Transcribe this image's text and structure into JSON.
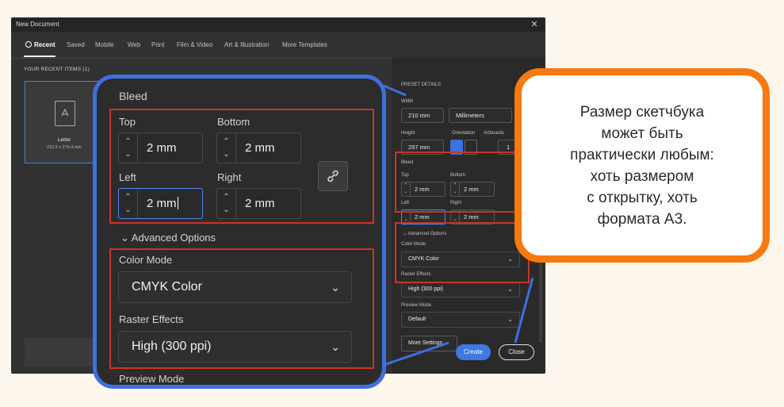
{
  "dialog": {
    "title": "New Document",
    "tabs": [
      "Recent",
      "Saved",
      "Mobile",
      "Web",
      "Print",
      "Film & Video",
      "Art & Illustration",
      "More Templates"
    ],
    "recent_heading": "YOUR RECENT ITEMS  (1)",
    "recent_item": {
      "label": "Letter",
      "size": "215.9 x 279.4 mm"
    }
  },
  "preset": {
    "heading": "PRESET DETAILS",
    "width_label": "Width",
    "width_value": "210 mm",
    "units_value": "Millimeters",
    "height_label": "Height",
    "height_value": "297 mm",
    "orientation_label": "Orientation",
    "artboards_label": "Artboards",
    "artboards_value": "1",
    "bleed_label": "Bleed",
    "top_label": "Top",
    "top_value": "2 mm",
    "bottom_label": "Bottom",
    "bottom_value": "2 mm",
    "left_label": "Left",
    "left_value": "2 mm",
    "right_label": "Right",
    "right_value": "2 mm",
    "advanced_label": "Advanced Options",
    "color_mode_label": "Color Mode",
    "color_mode_value": "CMYK Color",
    "raster_label": "Raster Effects",
    "raster_value": "High (300 ppi)",
    "preview_label": "Preview Mode",
    "preview_value": "Default",
    "more_settings": "More Settings",
    "create_label": "Create",
    "close_label": "Close"
  },
  "zoom": {
    "bleed_title": "Bleed",
    "top_label": "Top",
    "top_value": "2 mm",
    "bottom_label": "Bottom",
    "bottom_value": "2 mm",
    "left_label": "Left",
    "left_value": "2 mm",
    "right_label": "Right",
    "right_value": "2 mm",
    "advanced_label": "Advanced Options",
    "color_mode_label": "Color Mode",
    "color_mode_value": "CMYK Color",
    "raster_label": "Raster Effects",
    "raster_value": "High (300 ppi)",
    "preview_label": "Preview Mode"
  },
  "callout": {
    "text": "Размер скетчбука\nможет быть\nпрактически любым:\nхоть размером\nс открытку, хоть\nформата А3."
  },
  "colors": {
    "accent": "#3f6fe0",
    "highlight": "#c8352a",
    "callout_border": "#f57a12",
    "background": "#fdf6ec"
  }
}
